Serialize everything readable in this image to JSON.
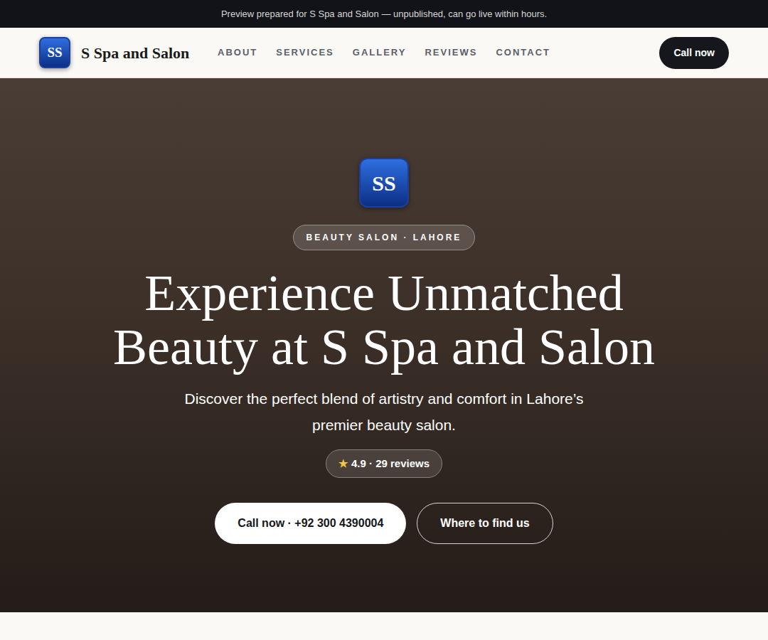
{
  "banner": {
    "text": "Preview prepared for S Spa and Salon — unpublished, can go live within hours."
  },
  "nav": {
    "logo": "SS",
    "brand": "S Spa and Salon",
    "links": [
      "ABOUT",
      "SERVICES",
      "GALLERY",
      "REVIEWS",
      "CONTACT"
    ],
    "cta": "Call now"
  },
  "hero": {
    "logo": "SS",
    "badge": "BEAUTY SALON · LAHORE",
    "heading": "Experience Unmatched Beauty at S Spa and Salon",
    "subtitle": "Discover the perfect blend of artistry and comfort in Lahore’s premier beauty salon.",
    "rating": {
      "star": "★",
      "text": "4.9 · 29 reviews"
    },
    "buttons": [
      {
        "label": "Call now · +92 300 4390004",
        "kind": "primary"
      },
      {
        "label": "Where to find us",
        "kind": "outline"
      }
    ]
  }
}
